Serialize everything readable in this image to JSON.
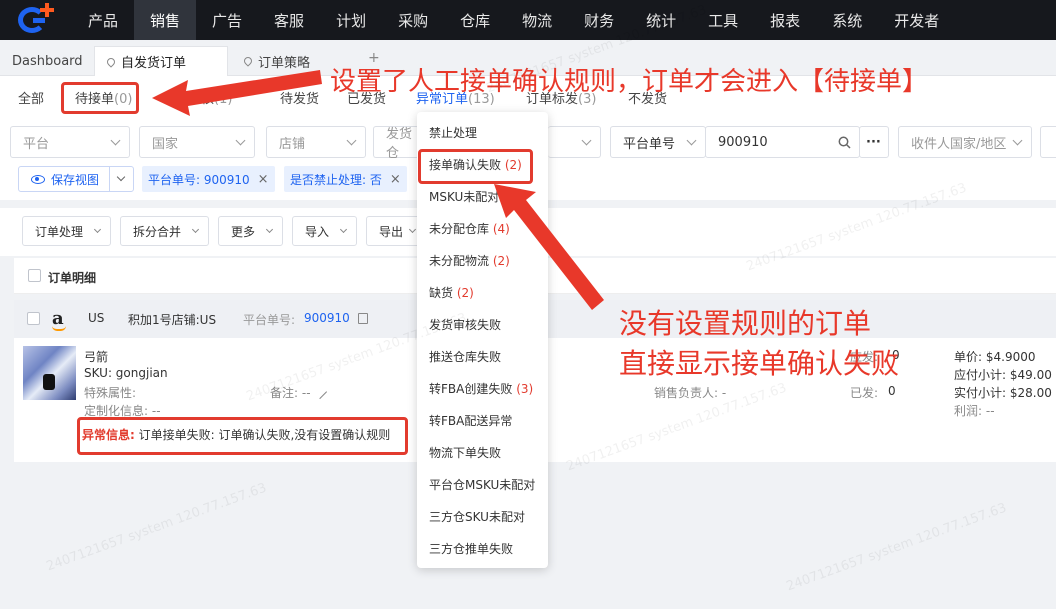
{
  "topnav": {
    "items": [
      "产品",
      "销售",
      "广告",
      "客服",
      "计划",
      "采购",
      "仓库",
      "物流",
      "财务",
      "统计",
      "工具",
      "报表",
      "系统",
      "开发者"
    ],
    "active_index": 1
  },
  "tabs": [
    "Dashboard",
    "自发货订单",
    "订单策略",
    "+"
  ],
  "subtabs": [
    {
      "label": "全部",
      "count": ""
    },
    {
      "label": "待接单",
      "count": "(0)"
    },
    {
      "label": "审核",
      "count": "(1)"
    },
    {
      "label": "待发货",
      "count": ""
    },
    {
      "label": "已发货",
      "count": ""
    },
    {
      "label": "异常订单",
      "count": "(13)"
    },
    {
      "label": "订单标发",
      "count": "(3)"
    },
    {
      "label": "不发货",
      "count": ""
    }
  ],
  "filters": {
    "platform": "平台",
    "country": "国家",
    "shop": "店铺",
    "warehouse": "发货仓",
    "order_no_type": "平台单号",
    "order_no_value": "900910",
    "more": "···",
    "receiver_country": "收件人国家/地区"
  },
  "chips": {
    "save_view": "保存视图",
    "chip1": "平台单号: 900910",
    "chip2": "是否禁止处理: 否"
  },
  "toolbar": [
    "订单处理",
    "拆分合并",
    "更多",
    "导入",
    "导出"
  ],
  "table": {
    "header": "订单明细"
  },
  "order": {
    "country": "US",
    "shop": "积加1号店铺:US",
    "platform_no_label": "平台单号:",
    "platform_no": "900910",
    "product_name": "弓箭",
    "sku": "SKU: gongjian",
    "special": "特殊属性:",
    "custom": "定制化信息: --",
    "remark": "备注: --",
    "sales_owner": "销售负责人: -",
    "qty_shipped_label": "应发:",
    "qty_shipped": "0",
    "qty_returned_label": "已发:",
    "qty_returned": "0",
    "unit_price": "单价: $4.9000",
    "subtotal_due": "应付小计: $49.00",
    "subtotal_paid": "实付小计: $28.00",
    "profit": "利润: --",
    "error_label": "异常信息:",
    "error_text": " 订单接单失败: 订单确认失败,没有设置确认规则"
  },
  "dropdown": [
    {
      "label": "禁止处理",
      "count": ""
    },
    {
      "label": "接单确认失败",
      "count": "(2)"
    },
    {
      "label": "MSKU未配对",
      "count": ""
    },
    {
      "label": "未分配仓库",
      "count": "(4)"
    },
    {
      "label": "未分配物流",
      "count": "(2)"
    },
    {
      "label": "缺货",
      "count": "(2)"
    },
    {
      "label": "发货审核失败",
      "count": ""
    },
    {
      "label": "推送仓库失败",
      "count": ""
    },
    {
      "label": "转FBA创建失败",
      "count": "(3)"
    },
    {
      "label": "转FBA配送异常",
      "count": ""
    },
    {
      "label": "物流下单失败",
      "count": ""
    },
    {
      "label": "平台仓MSKU未配对",
      "count": ""
    },
    {
      "label": "三方仓SKU未配对",
      "count": ""
    },
    {
      "label": "三方仓推单失败",
      "count": ""
    }
  ],
  "annotations": {
    "top": "设置了人工接单确认规则，订单才会进入【待接单】",
    "mid_line1": "没有设置规则的订单",
    "mid_line2": "直接显示接单确认失败"
  },
  "watermark": "2407121657 system 120.77.157.63",
  "colors": {
    "accent": "#1e63f0",
    "annotation_red": "#e23b2e",
    "nav_bg": "#16181d"
  }
}
